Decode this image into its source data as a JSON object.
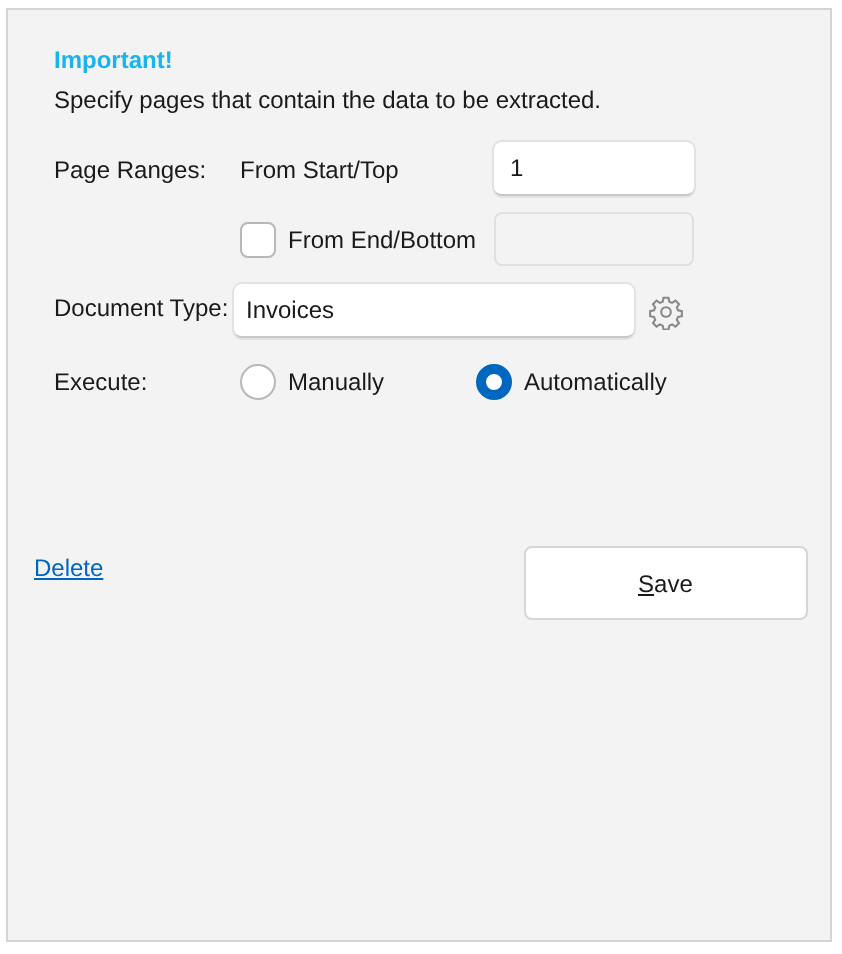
{
  "notice": {
    "title": "Important!",
    "text": "Specify pages that contain the data to be extracted."
  },
  "page_ranges": {
    "label": "Page Ranges:",
    "start_label": "From Start/Top",
    "start_value": "1",
    "end_label": "From End/Bottom",
    "end_checked": false
  },
  "document_type": {
    "label": "Document Type:",
    "value": "Invoices"
  },
  "execute": {
    "label": "Execute:",
    "options": [
      {
        "label": "Manually",
        "selected": false
      },
      {
        "label": "Automatically",
        "selected": true
      }
    ]
  },
  "delete_link": "Delete",
  "save_button": "Save"
}
